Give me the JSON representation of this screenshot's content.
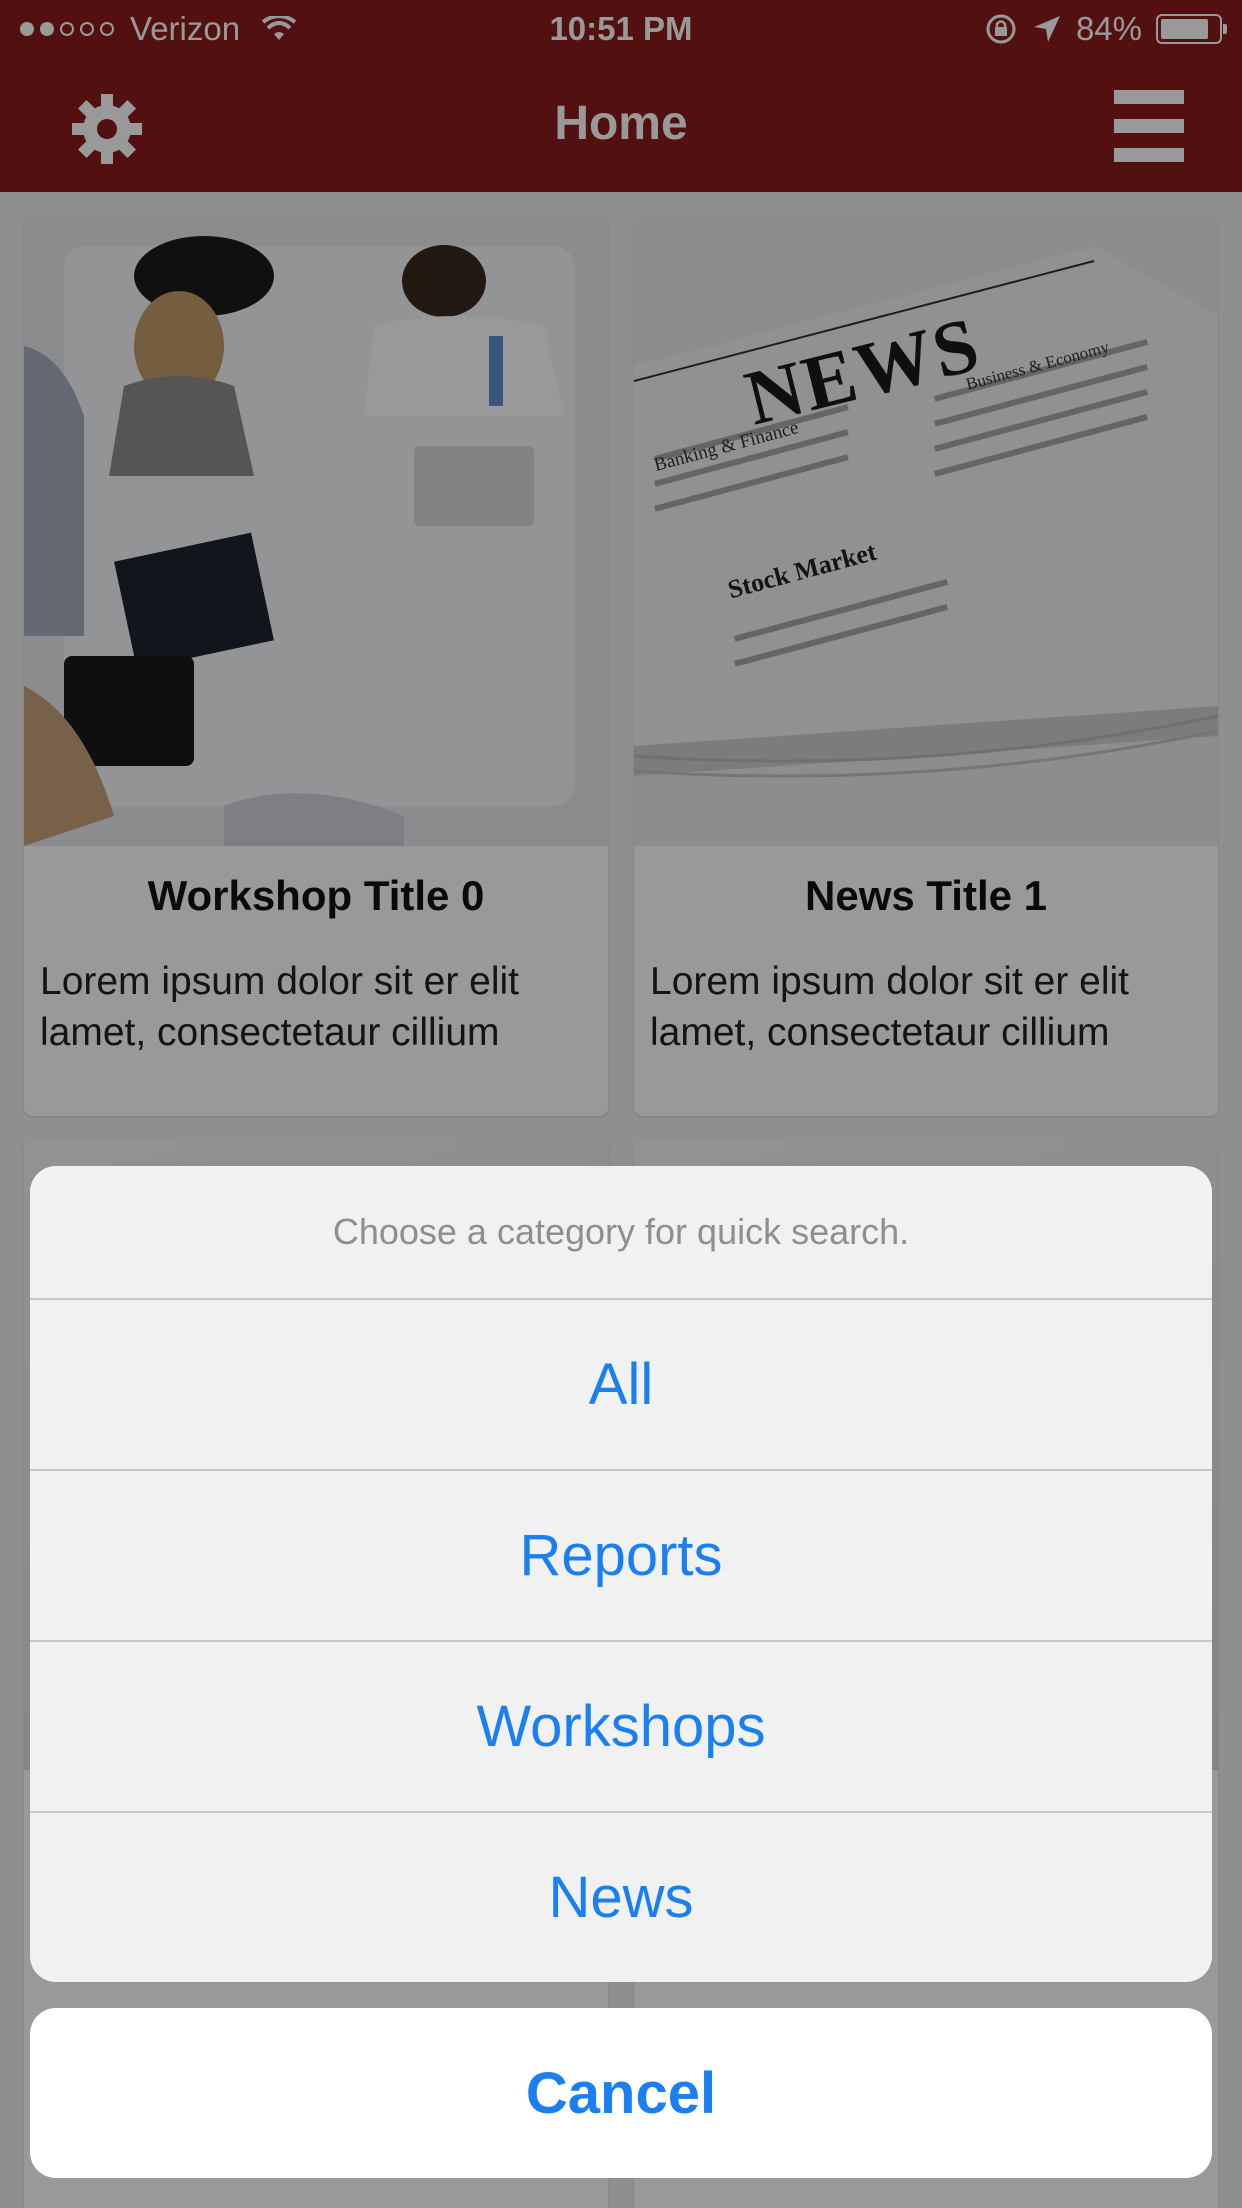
{
  "status_bar": {
    "carrier": "Verizon",
    "time": "10:51 PM",
    "battery": "84%",
    "battery_level": 0.84,
    "signal_bars_filled": 2,
    "signal_bars_total": 5
  },
  "nav": {
    "title": "Home",
    "color": "#8a1c1c"
  },
  "cards": [
    {
      "title": "Workshop Title 0",
      "desc": "Lorem ipsum dolor sit er elit lamet, consectetaur cillium",
      "image": "meeting-photo"
    },
    {
      "title": "News Title 1",
      "desc": "Lorem ipsum dolor sit er elit lamet, consectetaur cillium",
      "image": "newspaper-photo",
      "image_text": {
        "masthead": "NEWS",
        "col1": "Banking & Finance",
        "col2": "Business & Economy",
        "headline": "Stock Market"
      }
    }
  ],
  "action_sheet": {
    "message": "Choose a category for quick search.",
    "options": [
      "All",
      "Reports",
      "Workshops",
      "News"
    ],
    "cancel": "Cancel",
    "accent": "#1a7ff0"
  }
}
